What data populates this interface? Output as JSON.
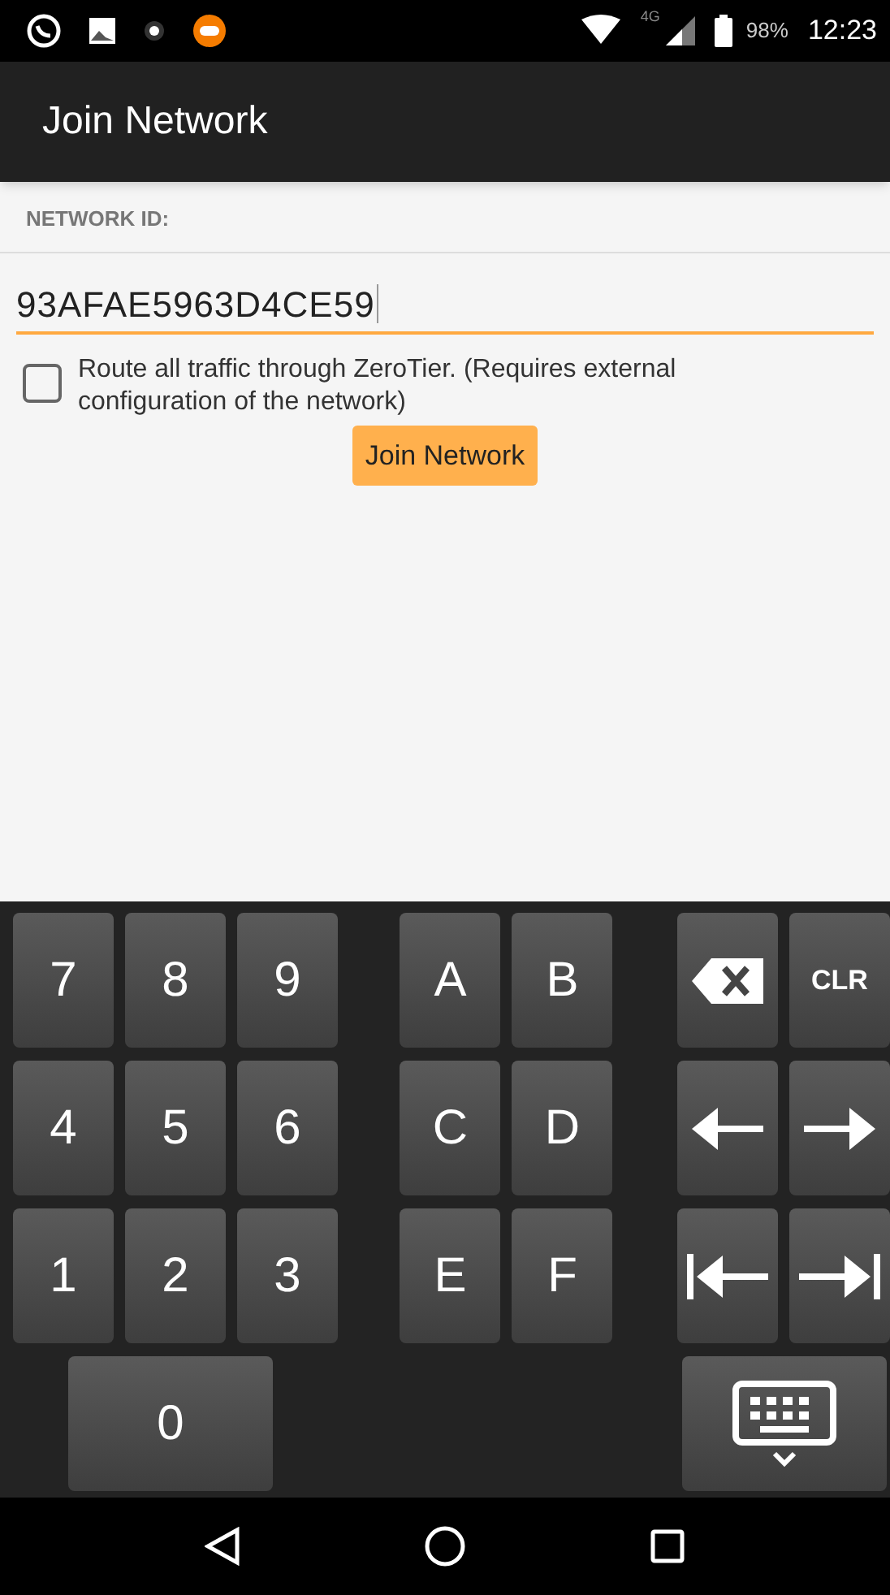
{
  "status_bar": {
    "network": "4G",
    "battery": "98%",
    "time": "12:23"
  },
  "app_bar": {
    "title": "Join Network"
  },
  "form": {
    "label": "NETWORK ID:",
    "value": "93AFAE5963D4CE59",
    "checkbox": {
      "label": "Route all traffic through ZeroTier. (Requires external configuration of the network)",
      "checked": false
    },
    "button": "Join Network"
  },
  "keyboard": {
    "rows": [
      {
        "digits": [
          {
            "kind": "text",
            "label": "7"
          },
          {
            "kind": "text",
            "label": "8"
          },
          {
            "kind": "text",
            "label": "9"
          }
        ],
        "letters": [
          {
            "kind": "text",
            "label": "A"
          },
          {
            "kind": "text",
            "label": "B"
          }
        ],
        "actions": [
          {
            "kind": "backspace"
          },
          {
            "kind": "small",
            "label": "CLR"
          }
        ]
      },
      {
        "digits": [
          {
            "kind": "text",
            "label": "4"
          },
          {
            "kind": "text",
            "label": "5"
          },
          {
            "kind": "text",
            "label": "6"
          }
        ],
        "letters": [
          {
            "kind": "text",
            "label": "C"
          },
          {
            "kind": "text",
            "label": "D"
          }
        ],
        "actions": [
          {
            "kind": "left"
          },
          {
            "kind": "right"
          }
        ]
      },
      {
        "digits": [
          {
            "kind": "text",
            "label": "1"
          },
          {
            "kind": "text",
            "label": "2"
          },
          {
            "kind": "text",
            "label": "3"
          }
        ],
        "letters": [
          {
            "kind": "text",
            "label": "E"
          },
          {
            "kind": "text",
            "label": "F"
          }
        ],
        "actions": [
          {
            "kind": "home"
          },
          {
            "kind": "end"
          }
        ]
      },
      {
        "digits": [
          {
            "kind": "zero",
            "label": "0"
          }
        ],
        "letters": [],
        "actions": [
          {
            "kind": "hide"
          }
        ]
      }
    ]
  }
}
